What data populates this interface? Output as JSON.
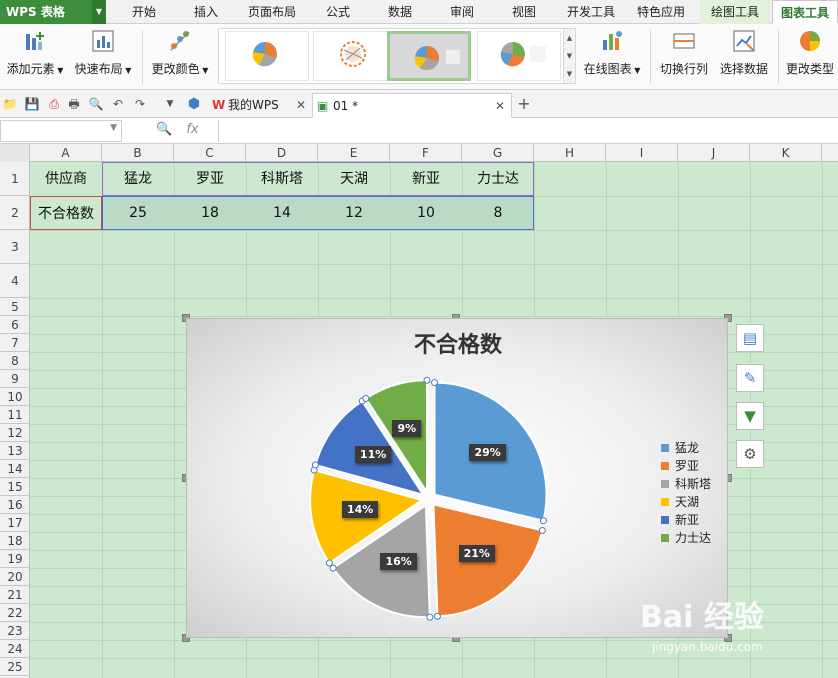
{
  "app": {
    "name": "WPS 表格"
  },
  "menu_tabs": [
    "开始",
    "插入",
    "页面布局",
    "公式",
    "数据",
    "审阅",
    "视图",
    "开发工具",
    "特色应用",
    "绘图工具",
    "图表工具"
  ],
  "ribbon": {
    "add_element": "添加元素",
    "quick_layout": "快速布局",
    "change_color": "更改颜色",
    "online_chart": "在线图表",
    "switch_row_col": "切换行列",
    "select_data": "选择数据",
    "change_type": "更改类型"
  },
  "doc_tabs": [
    {
      "label": "我的WPS"
    },
    {
      "label": "01 *"
    }
  ],
  "formula_bar": {
    "fx": "fx"
  },
  "columns": [
    "A",
    "B",
    "C",
    "D",
    "E",
    "F",
    "G",
    "H",
    "I",
    "J",
    "K"
  ],
  "rows": [
    "1",
    "2",
    "3",
    "4",
    "5",
    "6",
    "7",
    "8",
    "9",
    "10",
    "11",
    "12",
    "13",
    "14",
    "15",
    "16",
    "17",
    "18",
    "19",
    "20",
    "21",
    "22",
    "23",
    "24",
    "25"
  ],
  "table": {
    "header": [
      "供应商",
      "猛龙",
      "罗亚",
      "科斯塔",
      "天湖",
      "新亚",
      "力士达"
    ],
    "row2": [
      "不合格数",
      "25",
      "18",
      "14",
      "12",
      "10",
      "8"
    ]
  },
  "chart_data": {
    "type": "pie",
    "title": "不合格数",
    "categories": [
      "猛龙",
      "罗亚",
      "科斯塔",
      "天湖",
      "新亚",
      "力士达"
    ],
    "values": [
      25,
      18,
      14,
      12,
      10,
      8
    ],
    "percent_labels": [
      "29%",
      "21%",
      "16%",
      "14%",
      "11%",
      "9%"
    ],
    "colors": [
      "#5b9bd5",
      "#ed7d31",
      "#a5a5a5",
      "#ffc000",
      "#4472c4",
      "#70ad47"
    ],
    "legend": "right",
    "exploded": true
  },
  "watermark": {
    "brand": "Bai 经验",
    "url": "jingyan.baidu.com"
  }
}
